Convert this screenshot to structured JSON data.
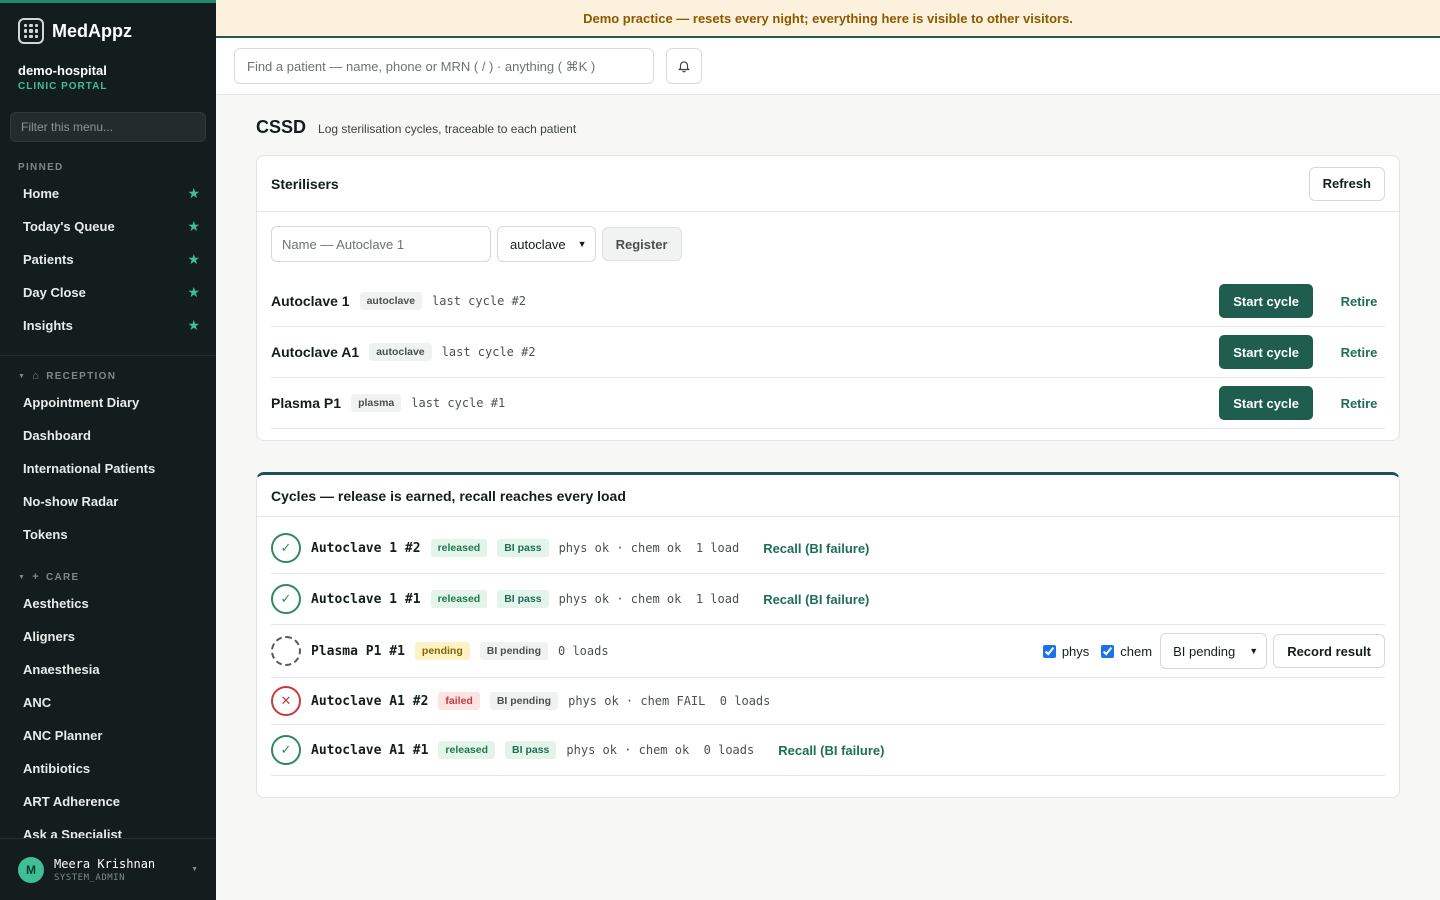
{
  "app": {
    "name": "MedAppz"
  },
  "org": {
    "name": "demo-hospital",
    "sub": "CLINIC PORTAL"
  },
  "sidebar": {
    "filter_placeholder": "Filter this menu...",
    "pinned_label": "PINNED",
    "pinned": [
      "Home",
      "Today's Queue",
      "Patients",
      "Day Close",
      "Insights"
    ],
    "reception_label": "RECEPTION",
    "reception": [
      "Appointment Diary",
      "Dashboard",
      "International Patients",
      "No-show Radar",
      "Tokens"
    ],
    "care_label": "CARE",
    "care": [
      "Aesthetics",
      "Aligners",
      "Anaesthesia",
      "ANC",
      "ANC Planner",
      "Antibiotics",
      "ART Adherence",
      "Ask a Specialist"
    ]
  },
  "user": {
    "initial": "M",
    "name": "Meera Krishnan",
    "role": "SYSTEM_ADMIN"
  },
  "banner": "Demo practice — resets every night; everything here is visible to other visitors.",
  "search": {
    "placeholder": "Find a patient — name, phone or MRN ( / ) · anything ( ⌘K )"
  },
  "page": {
    "title": "CSSD",
    "subtitle": "Log sterilisation cycles, traceable to each patient"
  },
  "sterilisers": {
    "title": "Sterilisers",
    "refresh_label": "Refresh",
    "name_placeholder": "Name — Autoclave 1",
    "type_selected": "autoclave",
    "register_label": "Register",
    "start_label": "Start cycle",
    "retire_label": "Retire",
    "items": [
      {
        "name": "Autoclave 1",
        "type": "autoclave",
        "last": "last cycle #2"
      },
      {
        "name": "Autoclave A1",
        "type": "autoclave",
        "last": "last cycle #2"
      },
      {
        "name": "Plasma P1",
        "type": "plasma",
        "last": "last cycle #1"
      }
    ]
  },
  "cycles": {
    "title": "Cycles — release is earned, recall reaches every load",
    "recall_label": "Recall (BI failure)",
    "items": [
      {
        "name": "Autoclave 1 #2",
        "status": "released",
        "bi": "BI pass",
        "note": "phys ok · chem ok  1 load"
      },
      {
        "name": "Autoclave 1 #1",
        "status": "released",
        "bi": "BI pass",
        "note": "phys ok · chem ok  1 load"
      },
      {
        "name": "Plasma P1 #1",
        "status": "pending",
        "bi": "BI pending",
        "note": "0 loads"
      },
      {
        "name": "Autoclave A1 #2",
        "status": "failed",
        "bi": "BI pending",
        "note": "phys ok · chem FAIL  0 loads"
      },
      {
        "name": "Autoclave A1 #1",
        "status": "released",
        "bi": "BI pass",
        "note": "phys ok · chem ok  0 loads"
      }
    ],
    "pending_controls": {
      "phys_label": "phys",
      "chem_label": "chem",
      "bi_selected": "BI pending",
      "record_label": "Record result"
    }
  },
  "colors": {
    "accent": "#1f5e4f",
    "sidebar_bg": "#141d1d",
    "banner_bg": "#fbf1dc",
    "star": "#3fbf94"
  }
}
